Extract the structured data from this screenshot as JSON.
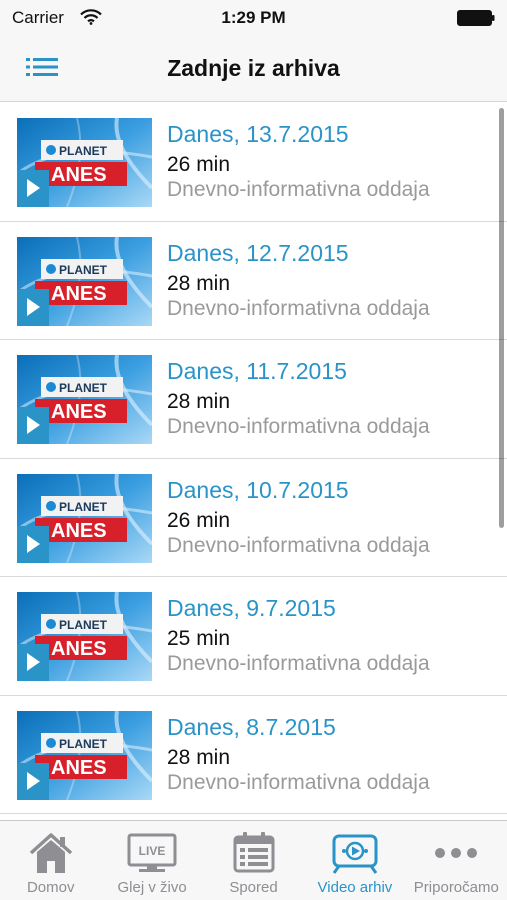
{
  "status_bar": {
    "carrier": "Carrier",
    "time": "1:29 PM"
  },
  "header": {
    "title": "Zadnje iz arhiva"
  },
  "thumbnail": {
    "brand": "PLANET",
    "show": "ANES"
  },
  "items": [
    {
      "title": "Danes, 13.7.2015",
      "duration": "26 min",
      "description": "Dnevno-informativna oddaja"
    },
    {
      "title": "Danes, 12.7.2015",
      "duration": "28 min",
      "description": "Dnevno-informativna oddaja"
    },
    {
      "title": "Danes, 11.7.2015",
      "duration": "28 min",
      "description": "Dnevno-informativna oddaja"
    },
    {
      "title": "Danes, 10.7.2015",
      "duration": "26 min",
      "description": "Dnevno-informativna oddaja"
    },
    {
      "title": "Danes, 9.7.2015",
      "duration": "25 min",
      "description": "Dnevno-informativna oddaja"
    },
    {
      "title": "Danes, 8.7.2015",
      "duration": "28 min",
      "description": "Dnevno-informativna oddaja"
    }
  ],
  "tabs": [
    {
      "label": "Domov",
      "icon": "home-icon"
    },
    {
      "label": "Glej v živo",
      "icon": "live-tv-icon",
      "badge": "LIVE"
    },
    {
      "label": "Spored",
      "icon": "calendar-icon"
    },
    {
      "label": "Video arhiv",
      "icon": "video-archive-icon",
      "active": true
    },
    {
      "label": "Priporočamo",
      "icon": "more-icon"
    }
  ],
  "colors": {
    "accent": "#2a93c7",
    "inactive": "#8e8e93",
    "bar_background": "#f7f7f8"
  }
}
